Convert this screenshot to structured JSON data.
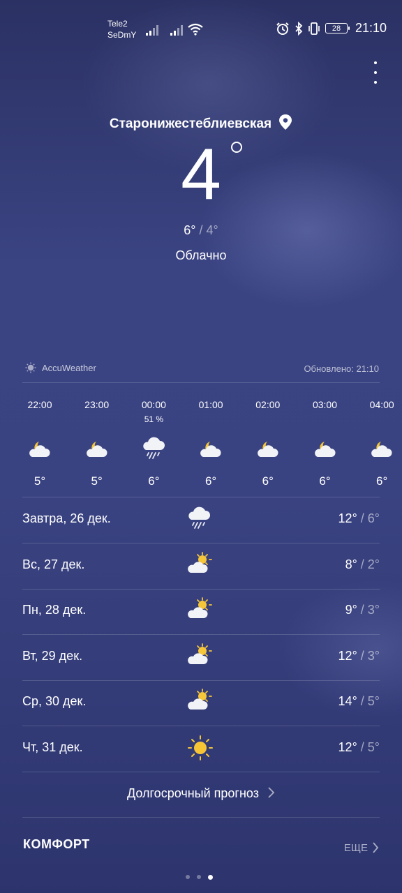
{
  "status_bar": {
    "carrier_line1": "Tele2",
    "carrier_line2": "SeDmY",
    "battery": "28",
    "time": "21:10",
    "icons": [
      "signal-icon",
      "signal-icon",
      "wifi-icon",
      "alarm-icon",
      "bluetooth-icon",
      "vibrate-icon",
      "battery-icon"
    ]
  },
  "header": {
    "location": "Старонижестеблиевская",
    "temp": "4",
    "high": "6°",
    "separator": " / ",
    "low": "4°",
    "condition": "Облачно"
  },
  "provider": {
    "name": "AccuWeather",
    "updated": "Обновлено: 21:10"
  },
  "hourly": [
    {
      "time": "22:00",
      "prob": "",
      "icon": "moon-cloud-icon",
      "temp": "5°"
    },
    {
      "time": "23:00",
      "prob": "",
      "icon": "moon-cloud-icon",
      "temp": "5°"
    },
    {
      "time": "00:00",
      "prob": "51 %",
      "icon": "rain-cloud-icon",
      "temp": "6°"
    },
    {
      "time": "01:00",
      "prob": "",
      "icon": "moon-cloud-icon",
      "temp": "6°"
    },
    {
      "time": "02:00",
      "prob": "",
      "icon": "moon-cloud-icon",
      "temp": "6°"
    },
    {
      "time": "03:00",
      "prob": "",
      "icon": "moon-cloud-icon",
      "temp": "6°"
    },
    {
      "time": "04:00",
      "prob": "",
      "icon": "moon-cloud-icon",
      "temp": "6°"
    }
  ],
  "daily": [
    {
      "label": "Завтра, 26 дек.",
      "icon": "rain-cloud-icon",
      "high": "12°",
      "low": " / 6°"
    },
    {
      "label": "Вс, 27 дек.",
      "icon": "sun-cloud-icon",
      "high": "8°",
      "low": " / 2°"
    },
    {
      "label": "Пн, 28 дек.",
      "icon": "sun-cloud-icon",
      "high": "9°",
      "low": " / 3°"
    },
    {
      "label": "Вт, 29 дек.",
      "icon": "sun-cloud-icon",
      "high": "12°",
      "low": " / 3°"
    },
    {
      "label": "Ср, 30 дек.",
      "icon": "sun-cloud-icon",
      "high": "14°",
      "low": " / 5°"
    },
    {
      "label": "Чт, 31 дек.",
      "icon": "sun-icon",
      "high": "12°",
      "low": " / 5°"
    }
  ],
  "long_forecast": "Долгосрочный прогноз",
  "comfort": {
    "title": "КОМФОРТ",
    "more": "ЕЩЕ"
  },
  "pager": {
    "count": 3,
    "active": 2
  }
}
